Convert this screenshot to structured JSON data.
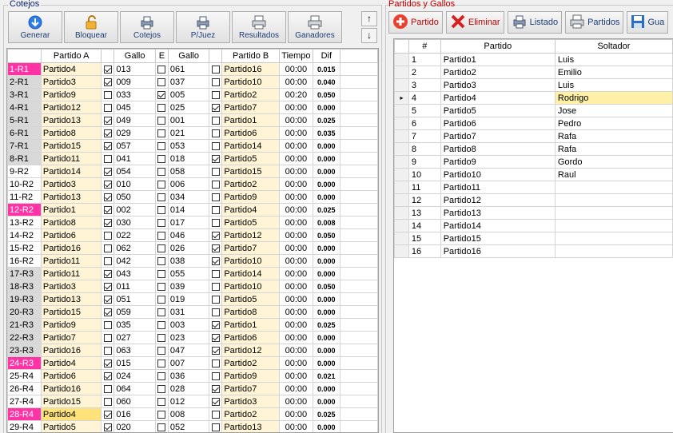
{
  "left": {
    "title": "Cotejos",
    "buttons": [
      {
        "label": "Generar",
        "icon": "download-arrow-icon"
      },
      {
        "label": "Bloquear",
        "icon": "unlock-icon"
      },
      {
        "label": "Cotejos",
        "icon": "print-icon"
      },
      {
        "label": "P/Juez",
        "icon": "print-icon"
      },
      {
        "label": "Resultados",
        "icon": "printer-icon"
      },
      {
        "label": "Ganadores",
        "icon": "printer-icon"
      }
    ],
    "scroll_up": "↑",
    "scroll_down": "↓",
    "columns": [
      "",
      "Partido A",
      "",
      "Gallo",
      "E",
      "Gallo",
      "",
      "Partido B",
      "Tiempo",
      "Dif"
    ],
    "rows": [
      {
        "id": "1-R1",
        "pa": "Partido4",
        "ca": true,
        "ga": "013",
        "e": false,
        "gb": "061",
        "cb": false,
        "pb": "Partido16",
        "t": "00:00",
        "d": "0.015",
        "style": "pink"
      },
      {
        "id": "2-R1",
        "pa": "Partido3",
        "ca": true,
        "ga": "009",
        "e": false,
        "gb": "037",
        "cb": false,
        "pb": "Partido10",
        "t": "00:00",
        "d": "0.040",
        "style": "gray"
      },
      {
        "id": "3-R1",
        "pa": "Partido9",
        "ca": false,
        "ga": "033",
        "e": true,
        "gb": "005",
        "cb": false,
        "pb": "Partido2",
        "t": "00:20",
        "d": "0.050",
        "style": "gray"
      },
      {
        "id": "4-R1",
        "pa": "Partido12",
        "ca": false,
        "ga": "045",
        "e": false,
        "gb": "025",
        "cb": true,
        "pb": "Partido7",
        "t": "00:00",
        "d": "0.000",
        "style": "gray"
      },
      {
        "id": "5-R1",
        "pa": "Partido13",
        "ca": true,
        "ga": "049",
        "e": false,
        "gb": "001",
        "cb": false,
        "pb": "Partido1",
        "t": "00:00",
        "d": "0.025",
        "style": "gray"
      },
      {
        "id": "6-R1",
        "pa": "Partido8",
        "ca": true,
        "ga": "029",
        "e": false,
        "gb": "021",
        "cb": false,
        "pb": "Partido6",
        "t": "00:00",
        "d": "0.035",
        "style": "gray"
      },
      {
        "id": "7-R1",
        "pa": "Partido15",
        "ca": true,
        "ga": "057",
        "e": false,
        "gb": "053",
        "cb": false,
        "pb": "Partido14",
        "t": "00:00",
        "d": "0.000",
        "style": "gray"
      },
      {
        "id": "8-R1",
        "pa": "Partido11",
        "ca": false,
        "ga": "041",
        "e": false,
        "gb": "018",
        "cb": true,
        "pb": "Partido5",
        "t": "00:00",
        "d": "0.000",
        "style": "gray"
      },
      {
        "id": "9-R2",
        "pa": "Partido14",
        "ca": true,
        "ga": "054",
        "e": false,
        "gb": "058",
        "cb": false,
        "pb": "Partido15",
        "t": "00:00",
        "d": "0.000",
        "style": ""
      },
      {
        "id": "10-R2",
        "pa": "Partido3",
        "ca": true,
        "ga": "010",
        "e": false,
        "gb": "006",
        "cb": false,
        "pb": "Partido2",
        "t": "00:00",
        "d": "0.000",
        "style": ""
      },
      {
        "id": "11-R2",
        "pa": "Partido13",
        "ca": true,
        "ga": "050",
        "e": false,
        "gb": "034",
        "cb": false,
        "pb": "Partido9",
        "t": "00:00",
        "d": "0.000",
        "style": ""
      },
      {
        "id": "12-R2",
        "pa": "Partido1",
        "ca": true,
        "ga": "002",
        "e": false,
        "gb": "014",
        "cb": false,
        "pb": "Partido4",
        "t": "00:00",
        "d": "0.025",
        "style": "pink"
      },
      {
        "id": "13-R2",
        "pa": "Partido8",
        "ca": true,
        "ga": "030",
        "e": false,
        "gb": "017",
        "cb": false,
        "pb": "Partido5",
        "t": "00:00",
        "d": "0.008",
        "style": ""
      },
      {
        "id": "14-R2",
        "pa": "Partido6",
        "ca": false,
        "ga": "022",
        "e": false,
        "gb": "046",
        "cb": true,
        "pb": "Partido12",
        "t": "00:00",
        "d": "0.050",
        "style": ""
      },
      {
        "id": "15-R2",
        "pa": "Partido16",
        "ca": false,
        "ga": "062",
        "e": false,
        "gb": "026",
        "cb": true,
        "pb": "Partido7",
        "t": "00:00",
        "d": "0.000",
        "style": ""
      },
      {
        "id": "16-R2",
        "pa": "Partido11",
        "ca": false,
        "ga": "042",
        "e": false,
        "gb": "038",
        "cb": true,
        "pb": "Partido10",
        "t": "00:00",
        "d": "0.000",
        "style": ""
      },
      {
        "id": "17-R3",
        "pa": "Partido11",
        "ca": true,
        "ga": "043",
        "e": false,
        "gb": "055",
        "cb": false,
        "pb": "Partido14",
        "t": "00:00",
        "d": "0.000",
        "style": "gray"
      },
      {
        "id": "18-R3",
        "pa": "Partido3",
        "ca": true,
        "ga": "011",
        "e": false,
        "gb": "039",
        "cb": false,
        "pb": "Partido10",
        "t": "00:00",
        "d": "0.050",
        "style": "gray"
      },
      {
        "id": "19-R3",
        "pa": "Partido13",
        "ca": true,
        "ga": "051",
        "e": false,
        "gb": "019",
        "cb": false,
        "pb": "Partido5",
        "t": "00:00",
        "d": "0.000",
        "style": "gray"
      },
      {
        "id": "20-R3",
        "pa": "Partido15",
        "ca": true,
        "ga": "059",
        "e": false,
        "gb": "031",
        "cb": false,
        "pb": "Partido8",
        "t": "00:00",
        "d": "0.000",
        "style": "gray"
      },
      {
        "id": "21-R3",
        "pa": "Partido9",
        "ca": false,
        "ga": "035",
        "e": false,
        "gb": "003",
        "cb": true,
        "pb": "Partido1",
        "t": "00:00",
        "d": "0.025",
        "style": "gray"
      },
      {
        "id": "22-R3",
        "pa": "Partido7",
        "ca": false,
        "ga": "027",
        "e": false,
        "gb": "023",
        "cb": true,
        "pb": "Partido6",
        "t": "00:00",
        "d": "0.000",
        "style": "gray"
      },
      {
        "id": "23-R3",
        "pa": "Partido16",
        "ca": false,
        "ga": "063",
        "e": false,
        "gb": "047",
        "cb": true,
        "pb": "Partido12",
        "t": "00:00",
        "d": "0.000",
        "style": "gray"
      },
      {
        "id": "24-R3",
        "pa": "Partido4",
        "ca": true,
        "ga": "015",
        "e": false,
        "gb": "007",
        "cb": false,
        "pb": "Partido2",
        "t": "00:00",
        "d": "0.000",
        "style": "pink"
      },
      {
        "id": "25-R4",
        "pa": "Partido6",
        "ca": true,
        "ga": "024",
        "e": false,
        "gb": "036",
        "cb": false,
        "pb": "Partido9",
        "t": "00:00",
        "d": "0.021",
        "style": ""
      },
      {
        "id": "26-R4",
        "pa": "Partido16",
        "ca": false,
        "ga": "064",
        "e": false,
        "gb": "028",
        "cb": true,
        "pb": "Partido7",
        "t": "00:00",
        "d": "0.000",
        "style": ""
      },
      {
        "id": "27-R4",
        "pa": "Partido15",
        "ca": false,
        "ga": "060",
        "e": false,
        "gb": "012",
        "cb": true,
        "pb": "Partido3",
        "t": "00:00",
        "d": "0.000",
        "style": ""
      },
      {
        "id": "28-R4",
        "pa": "Partido4",
        "ca": true,
        "ga": "016",
        "e": false,
        "gb": "008",
        "cb": false,
        "pb": "Partido2",
        "t": "00:00",
        "d": "0.025",
        "style": "pink",
        "hl": true
      },
      {
        "id": "29-R4",
        "pa": "Partido5",
        "ca": true,
        "ga": "020",
        "e": false,
        "gb": "052",
        "cb": false,
        "pb": "Partido13",
        "t": "00:00",
        "d": "0.000",
        "style": ""
      }
    ]
  },
  "right": {
    "title": "Partidos y Gallos",
    "buttons": [
      {
        "label": "Partido",
        "icon": "add-circle-icon"
      },
      {
        "label": "Eliminar",
        "icon": "delete-x-icon"
      },
      {
        "label": "Listado",
        "icon": "print-icon"
      },
      {
        "label": "Partidos",
        "icon": "printer-icon"
      },
      {
        "label": "Gua",
        "icon": "save-icon"
      }
    ],
    "columns": [
      "",
      "#",
      "Partido",
      "Soltador"
    ],
    "selected_marker": "▸",
    "rows": [
      {
        "n": "1",
        "partido": "Partido1",
        "soltador": "Luis"
      },
      {
        "n": "2",
        "partido": "Partido2",
        "soltador": "Emilio"
      },
      {
        "n": "3",
        "partido": "Partido3",
        "soltador": "Luis"
      },
      {
        "n": "4",
        "partido": "Partido4",
        "soltador": "Rodrigo",
        "current": true
      },
      {
        "n": "5",
        "partido": "Partido5",
        "soltador": "Jose"
      },
      {
        "n": "6",
        "partido": "Partido6",
        "soltador": "Pedro"
      },
      {
        "n": "7",
        "partido": "Partido7",
        "soltador": "Rafa"
      },
      {
        "n": "8",
        "partido": "Partido8",
        "soltador": "Rafa"
      },
      {
        "n": "9",
        "partido": "Partido9",
        "soltador": "Gordo"
      },
      {
        "n": "10",
        "partido": "Partido10",
        "soltador": "Raul"
      },
      {
        "n": "11",
        "partido": "Partido11",
        "soltador": ""
      },
      {
        "n": "12",
        "partido": "Partido12",
        "soltador": ""
      },
      {
        "n": "13",
        "partido": "Partido13",
        "soltador": ""
      },
      {
        "n": "14",
        "partido": "Partido14",
        "soltador": ""
      },
      {
        "n": "15",
        "partido": "Partido15",
        "soltador": ""
      },
      {
        "n": "16",
        "partido": "Partido16",
        "soltador": ""
      }
    ]
  },
  "colors": {
    "pink_row": "#ff33a5",
    "gray_row": "#d9d9d9",
    "partido_bg": "#fff5d6",
    "accent_red": "#c00000",
    "accent_blue": "#1c3c78"
  }
}
